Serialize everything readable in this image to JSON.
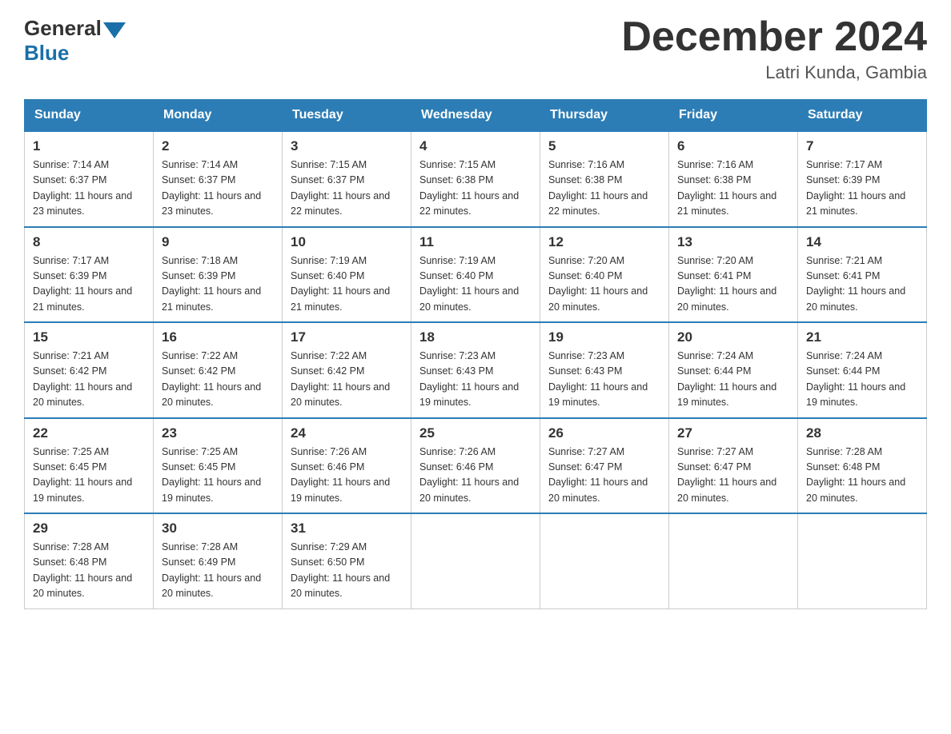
{
  "header": {
    "logo_general": "General",
    "logo_blue": "Blue",
    "title": "December 2024",
    "location": "Latri Kunda, Gambia"
  },
  "days_of_week": [
    "Sunday",
    "Monday",
    "Tuesday",
    "Wednesday",
    "Thursday",
    "Friday",
    "Saturday"
  ],
  "weeks": [
    [
      {
        "day": "1",
        "sunrise": "7:14 AM",
        "sunset": "6:37 PM",
        "daylight": "11 hours and 23 minutes."
      },
      {
        "day": "2",
        "sunrise": "7:14 AM",
        "sunset": "6:37 PM",
        "daylight": "11 hours and 23 minutes."
      },
      {
        "day": "3",
        "sunrise": "7:15 AM",
        "sunset": "6:37 PM",
        "daylight": "11 hours and 22 minutes."
      },
      {
        "day": "4",
        "sunrise": "7:15 AM",
        "sunset": "6:38 PM",
        "daylight": "11 hours and 22 minutes."
      },
      {
        "day": "5",
        "sunrise": "7:16 AM",
        "sunset": "6:38 PM",
        "daylight": "11 hours and 22 minutes."
      },
      {
        "day": "6",
        "sunrise": "7:16 AM",
        "sunset": "6:38 PM",
        "daylight": "11 hours and 21 minutes."
      },
      {
        "day": "7",
        "sunrise": "7:17 AM",
        "sunset": "6:39 PM",
        "daylight": "11 hours and 21 minutes."
      }
    ],
    [
      {
        "day": "8",
        "sunrise": "7:17 AM",
        "sunset": "6:39 PM",
        "daylight": "11 hours and 21 minutes."
      },
      {
        "day": "9",
        "sunrise": "7:18 AM",
        "sunset": "6:39 PM",
        "daylight": "11 hours and 21 minutes."
      },
      {
        "day": "10",
        "sunrise": "7:19 AM",
        "sunset": "6:40 PM",
        "daylight": "11 hours and 21 minutes."
      },
      {
        "day": "11",
        "sunrise": "7:19 AM",
        "sunset": "6:40 PM",
        "daylight": "11 hours and 20 minutes."
      },
      {
        "day": "12",
        "sunrise": "7:20 AM",
        "sunset": "6:40 PM",
        "daylight": "11 hours and 20 minutes."
      },
      {
        "day": "13",
        "sunrise": "7:20 AM",
        "sunset": "6:41 PM",
        "daylight": "11 hours and 20 minutes."
      },
      {
        "day": "14",
        "sunrise": "7:21 AM",
        "sunset": "6:41 PM",
        "daylight": "11 hours and 20 minutes."
      }
    ],
    [
      {
        "day": "15",
        "sunrise": "7:21 AM",
        "sunset": "6:42 PM",
        "daylight": "11 hours and 20 minutes."
      },
      {
        "day": "16",
        "sunrise": "7:22 AM",
        "sunset": "6:42 PM",
        "daylight": "11 hours and 20 minutes."
      },
      {
        "day": "17",
        "sunrise": "7:22 AM",
        "sunset": "6:42 PM",
        "daylight": "11 hours and 20 minutes."
      },
      {
        "day": "18",
        "sunrise": "7:23 AM",
        "sunset": "6:43 PM",
        "daylight": "11 hours and 19 minutes."
      },
      {
        "day": "19",
        "sunrise": "7:23 AM",
        "sunset": "6:43 PM",
        "daylight": "11 hours and 19 minutes."
      },
      {
        "day": "20",
        "sunrise": "7:24 AM",
        "sunset": "6:44 PM",
        "daylight": "11 hours and 19 minutes."
      },
      {
        "day": "21",
        "sunrise": "7:24 AM",
        "sunset": "6:44 PM",
        "daylight": "11 hours and 19 minutes."
      }
    ],
    [
      {
        "day": "22",
        "sunrise": "7:25 AM",
        "sunset": "6:45 PM",
        "daylight": "11 hours and 19 minutes."
      },
      {
        "day": "23",
        "sunrise": "7:25 AM",
        "sunset": "6:45 PM",
        "daylight": "11 hours and 19 minutes."
      },
      {
        "day": "24",
        "sunrise": "7:26 AM",
        "sunset": "6:46 PM",
        "daylight": "11 hours and 19 minutes."
      },
      {
        "day": "25",
        "sunrise": "7:26 AM",
        "sunset": "6:46 PM",
        "daylight": "11 hours and 20 minutes."
      },
      {
        "day": "26",
        "sunrise": "7:27 AM",
        "sunset": "6:47 PM",
        "daylight": "11 hours and 20 minutes."
      },
      {
        "day": "27",
        "sunrise": "7:27 AM",
        "sunset": "6:47 PM",
        "daylight": "11 hours and 20 minutes."
      },
      {
        "day": "28",
        "sunrise": "7:28 AM",
        "sunset": "6:48 PM",
        "daylight": "11 hours and 20 minutes."
      }
    ],
    [
      {
        "day": "29",
        "sunrise": "7:28 AM",
        "sunset": "6:48 PM",
        "daylight": "11 hours and 20 minutes."
      },
      {
        "day": "30",
        "sunrise": "7:28 AM",
        "sunset": "6:49 PM",
        "daylight": "11 hours and 20 minutes."
      },
      {
        "day": "31",
        "sunrise": "7:29 AM",
        "sunset": "6:50 PM",
        "daylight": "11 hours and 20 minutes."
      },
      null,
      null,
      null,
      null
    ]
  ],
  "labels": {
    "sunrise": "Sunrise:",
    "sunset": "Sunset:",
    "daylight": "Daylight:"
  }
}
